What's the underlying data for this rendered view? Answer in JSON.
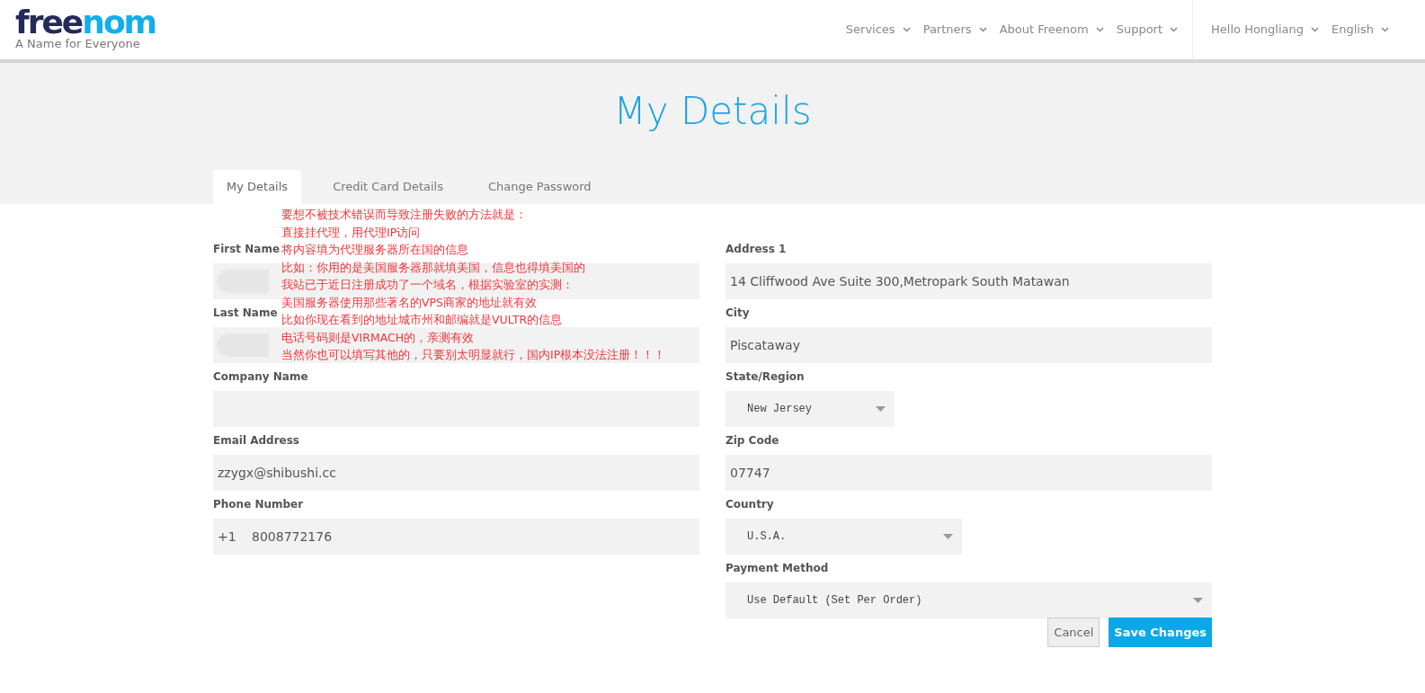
{
  "header": {
    "logo": {
      "part_1": "free",
      "part_2": "nom"
    },
    "tagline": "A Name for Everyone",
    "nav": [
      "Services",
      "Partners",
      "About Freenom",
      "Support"
    ],
    "account": [
      "Hello Hongliang",
      "English"
    ]
  },
  "page_title": "My Details",
  "tabs": [
    {
      "label": "My Details",
      "selected": true
    },
    {
      "label": "Credit Card Details",
      "selected": false
    },
    {
      "label": "Change Password",
      "selected": false
    }
  ],
  "form": {
    "left": [
      {
        "label": "First Name",
        "kind": "redacted"
      },
      {
        "label": "Last Name",
        "kind": "redacted"
      },
      {
        "label": "Company Name",
        "kind": "text"
      },
      {
        "label": "Email Address",
        "kind": "text",
        "value": "zzygx@shibushi.cc"
      },
      {
        "label": "Phone Number",
        "kind": "phone",
        "prefix": "+1",
        "value": "8008772176"
      }
    ],
    "right": [
      {
        "label": "Address 1",
        "kind": "text",
        "value": "14 Cliffwood Ave Suite 300,Metropark South Matawan"
      },
      {
        "label": "City",
        "kind": "text",
        "value": "Piscataway"
      },
      {
        "label": "State/Region",
        "kind": "select",
        "value": "New Jersey"
      },
      {
        "label": "Zip Code",
        "kind": "text",
        "value": "07747"
      },
      {
        "label": "Country",
        "kind": "select",
        "value": "U.S.A."
      },
      {
        "label": "Payment Method",
        "kind": "select",
        "value": "Use Default (Set Per Order)"
      }
    ],
    "buttons": [
      {
        "label": "Cancel",
        "kind": "secondary"
      },
      {
        "label": "Save Changes",
        "kind": "primary"
      }
    ]
  },
  "annotation": [
    "要想不被技术错误而导致注册失败的方法就是：",
    "直接挂代理，用代理IP访问",
    "将内容填为代理服务器所在国的信息",
    "比如：你用的是美国服务器那就填美国，信息也得填美国的",
    "我站已于近日注册成功了一个域名，根据实验室的实测：",
    "美国服务器使用那些著名的VPS商家的地址就有效",
    "比如你现在看到的地址城市州和邮编就是VULTR的信息",
    "电话号码则是VIRMACH的，亲测有效",
    "当然你也可以填写其他的，只要别太明显就行，国内IP根本没法注册！！！"
  ]
}
